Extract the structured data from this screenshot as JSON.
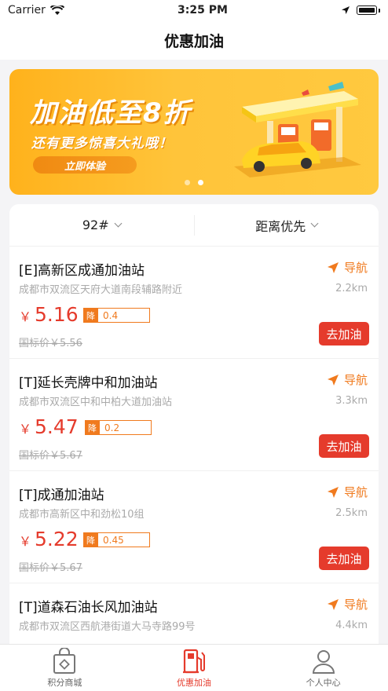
{
  "status_bar": {
    "carrier": "Carrier",
    "time": "3:25 PM"
  },
  "nav": {
    "title": "优惠加油"
  },
  "banner": {
    "title": "加油低至8折",
    "subtitle": "还有更多惊喜大礼哦！",
    "button": "立即体验",
    "page_count": 2,
    "active_page": 2
  },
  "filters": {
    "fuel": "92#",
    "sort": "距离优先"
  },
  "colors": {
    "accent": "#e53b2c",
    "orange": "#f07a1e",
    "banner": "#ffc43a"
  },
  "nav_label": "导航",
  "go_label": "去加油",
  "discount_tag": "降",
  "stations": [
    {
      "name": "[E]高新区成通加油站",
      "address": "成都市双流区天府大道南段辅路附近",
      "distance": "2.2km",
      "price": "5.16",
      "discount": "0.4",
      "std_price": "国标价￥5.56"
    },
    {
      "name": "[T]延长壳牌中和加油站",
      "address": "成都市双流区中和中柏大道加油站",
      "distance": "3.3km",
      "price": "5.47",
      "discount": "0.2",
      "std_price": "国标价￥5.67"
    },
    {
      "name": "[T]成通加油站",
      "address": "成都市高新区中和劲松10组",
      "distance": "2.5km",
      "price": "5.22",
      "discount": "0.45",
      "std_price": "国标价￥5.67"
    },
    {
      "name": "[T]道森石油长风加油站",
      "address": "成都市双流区西航港街道大马寺路99号",
      "distance": "4.4km"
    }
  ],
  "yen": "￥",
  "tabs": [
    {
      "label": "积分商城",
      "icon": "shopping-bag-icon"
    },
    {
      "label": "优惠加油",
      "icon": "fuel-pump-icon"
    },
    {
      "label": "个人中心",
      "icon": "user-icon"
    }
  ]
}
